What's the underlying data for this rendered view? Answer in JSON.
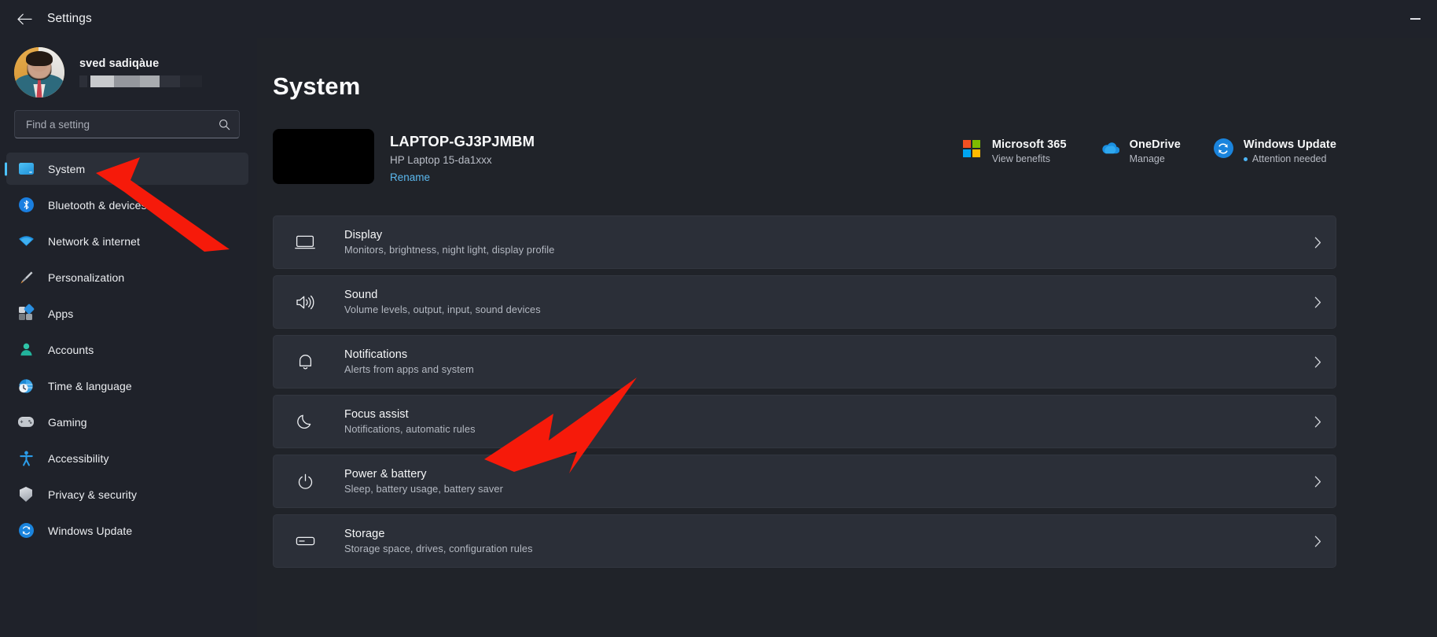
{
  "titlebar": {
    "back_icon": "back-arrow-icon",
    "title": "Settings",
    "minimize_icon": "minimize-icon"
  },
  "sidebar": {
    "profile": {
      "name": "sved sadiqàue",
      "email_redacted": true,
      "avatar_icon": "user-avatar-photo"
    },
    "search": {
      "placeholder": "Find a setting",
      "value": "",
      "icon": "search-icon"
    },
    "items": [
      {
        "label": "System",
        "icon": "system-icon",
        "active": true
      },
      {
        "label": "Bluetooth & devices",
        "icon": "bluetooth-icon",
        "active": false
      },
      {
        "label": "Network & internet",
        "icon": "wifi-icon",
        "active": false
      },
      {
        "label": "Personalization",
        "icon": "paintbrush-icon",
        "active": false
      },
      {
        "label": "Apps",
        "icon": "apps-icon",
        "active": false
      },
      {
        "label": "Accounts",
        "icon": "account-person-icon",
        "active": false
      },
      {
        "label": "Time & language",
        "icon": "clock-globe-icon",
        "active": false
      },
      {
        "label": "Gaming",
        "icon": "gamepad-icon",
        "active": false
      },
      {
        "label": "Accessibility",
        "icon": "accessibility-icon",
        "active": false
      },
      {
        "label": "Privacy & security",
        "icon": "shield-icon",
        "active": false
      },
      {
        "label": "Windows Update",
        "icon": "update-refresh-icon",
        "active": false
      }
    ]
  },
  "main": {
    "page_title": "System",
    "device": {
      "name": "LAPTOP-GJ3PJMBM",
      "model": "HP Laptop 15-da1xxx",
      "rename_label": "Rename",
      "thumbnail_icon": "device-thumbnail"
    },
    "quick_links": [
      {
        "title": "Microsoft 365",
        "subtitle": "View benefits",
        "icon": "microsoft-logo-icon",
        "has_dot": false
      },
      {
        "title": "OneDrive",
        "subtitle": "Manage",
        "icon": "onedrive-cloud-icon",
        "has_dot": false
      },
      {
        "title": "Windows Update",
        "subtitle": "Attention needed",
        "icon": "update-refresh-icon",
        "has_dot": true
      }
    ],
    "settings_rows": [
      {
        "title": "Display",
        "subtitle": "Monitors, brightness, night light, display profile",
        "icon": "monitor-icon",
        "chevron": "chevron-right-icon"
      },
      {
        "title": "Sound",
        "subtitle": "Volume levels, output, input, sound devices",
        "icon": "speaker-icon",
        "chevron": "chevron-right-icon"
      },
      {
        "title": "Notifications",
        "subtitle": "Alerts from apps and system",
        "icon": "bell-icon",
        "chevron": "chevron-right-icon"
      },
      {
        "title": "Focus assist",
        "subtitle": "Notifications, automatic rules",
        "icon": "moon-icon",
        "chevron": "chevron-right-icon"
      },
      {
        "title": "Power & battery",
        "subtitle": "Sleep, battery usage, battery saver",
        "icon": "power-icon",
        "chevron": "chevron-right-icon"
      },
      {
        "title": "Storage",
        "subtitle": "Storage space, drives, configuration rules",
        "icon": "storage-icon",
        "chevron": "chevron-right-icon"
      }
    ]
  },
  "annotations": {
    "color": "#f61a0a",
    "arrows": [
      {
        "name": "arrow-pointing-to-system",
        "target": "System"
      },
      {
        "name": "arrow-pointing-to-power-battery",
        "target": "Power & battery"
      }
    ]
  },
  "colors": {
    "accent": "#4cc2ff",
    "sidebar_bg": "#1f222a",
    "content_bg": "#202329",
    "card_bg": "#2b2f38",
    "annotation_red": "#f61a0a",
    "link_blue": "#5bb8ee"
  }
}
